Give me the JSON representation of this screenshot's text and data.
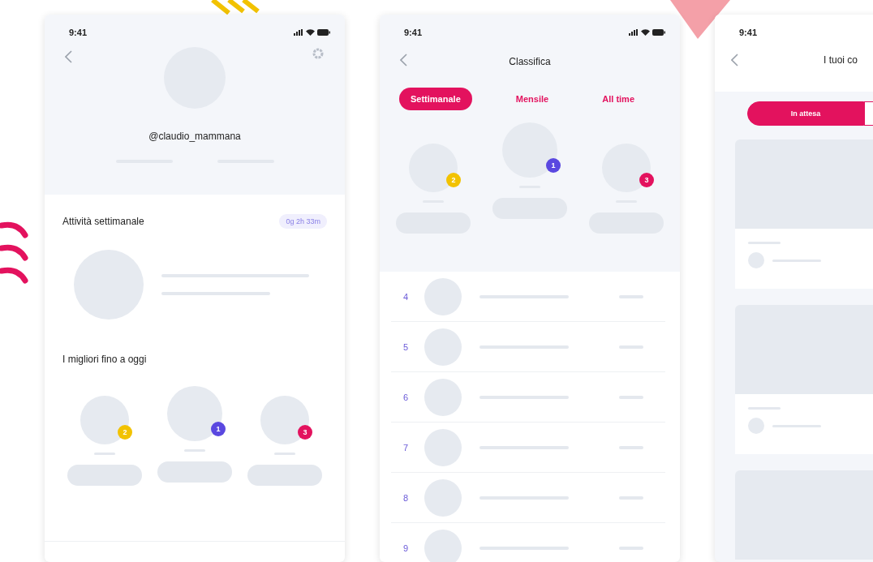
{
  "profile": {
    "status_time": "9:41",
    "username": "@claudio_mammana",
    "weekly": {
      "title": "Attività settimanale",
      "badge": "0g 2h 33m"
    },
    "best": {
      "title": "I migliori fino a oggi",
      "podium": [
        {
          "rank": "2",
          "color": "#f2c200"
        },
        {
          "rank": "1",
          "color": "#5a48e0"
        },
        {
          "rank": "3",
          "color": "#e3125e"
        }
      ]
    }
  },
  "leaderboard": {
    "status_time": "9:41",
    "title": "Classifica",
    "tabs": [
      {
        "label": "Settimanale",
        "selected": true
      },
      {
        "label": "Mensile",
        "selected": false
      },
      {
        "label": "All time",
        "selected": false
      }
    ],
    "podium": [
      {
        "rank": "2",
        "color": "#f2c200"
      },
      {
        "rank": "1",
        "color": "#5a48e0"
      },
      {
        "rank": "3",
        "color": "#e3125e"
      }
    ],
    "rows": [
      {
        "rank": "4"
      },
      {
        "rank": "5"
      },
      {
        "rank": "6"
      },
      {
        "rank": "7"
      },
      {
        "rank": "8"
      },
      {
        "rank": "9"
      }
    ]
  },
  "codes": {
    "status_time": "9:41",
    "title": "I tuoi co",
    "tabs": [
      {
        "label": "In attesa",
        "selected": true
      },
      {
        "selected": false
      }
    ]
  }
}
